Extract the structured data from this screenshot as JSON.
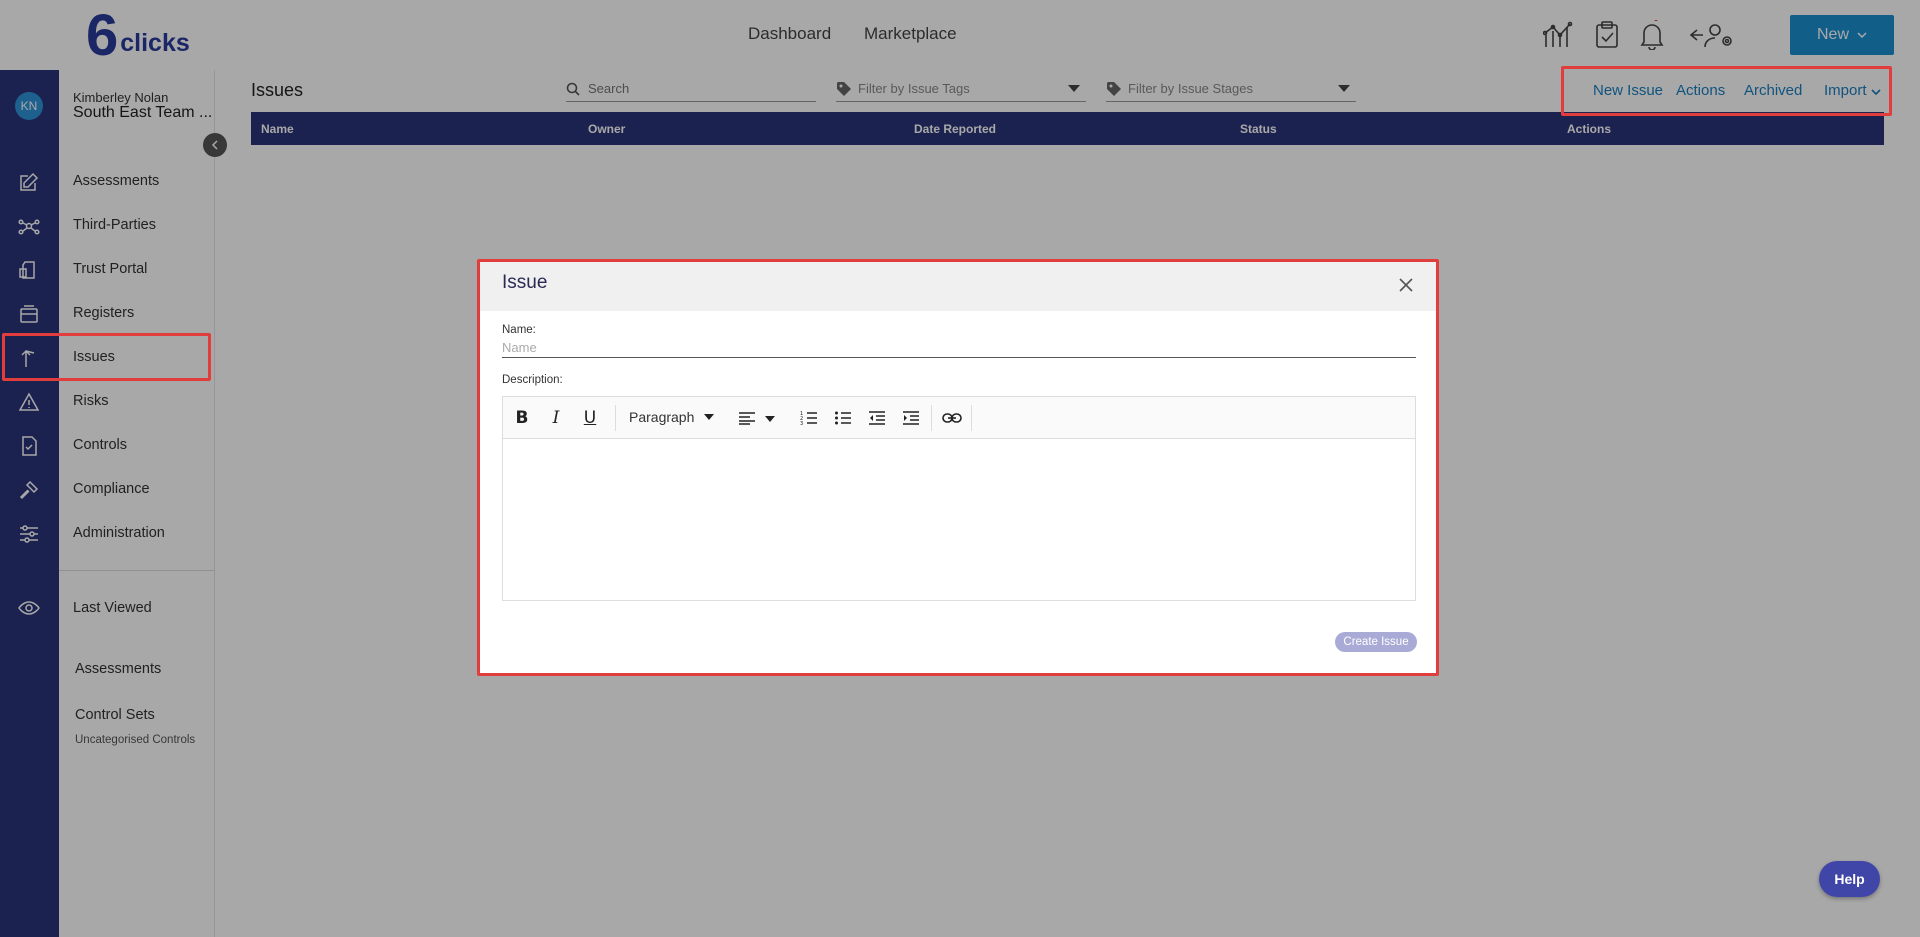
{
  "header": {
    "logo_mark": "6",
    "logo_text": "clicks",
    "nav": [
      "Dashboard",
      "Marketplace"
    ],
    "new_button": "New"
  },
  "user": {
    "initials": "KN",
    "name": "Kimberley Nolan",
    "team": "South East Team ..."
  },
  "sidebar": {
    "items": [
      "Assessments",
      "Third-Parties",
      "Trust Portal",
      "Registers",
      "Issues",
      "Risks",
      "Controls",
      "Compliance",
      "Administration"
    ],
    "last_viewed": "Last Viewed",
    "recent": [
      "Assessments",
      "Control Sets"
    ],
    "recent_sub": "Uncategorised Controls"
  },
  "page": {
    "title": "Issues",
    "search_placeholder": "Search",
    "filter_tags": "Filter by Issue Tags",
    "filter_stages": "Filter by Issue Stages",
    "actions": [
      "New Issue",
      "Actions",
      "Archived",
      "Import"
    ],
    "columns": [
      "Name",
      "Owner",
      "Date Reported",
      "Status",
      "Actions"
    ]
  },
  "modal": {
    "title": "Issue",
    "name_label": "Name:",
    "name_placeholder": "Name",
    "description_label": "Description:",
    "paragraph_label": "Paragraph",
    "create_button": "Create Issue"
  },
  "help": "Help"
}
